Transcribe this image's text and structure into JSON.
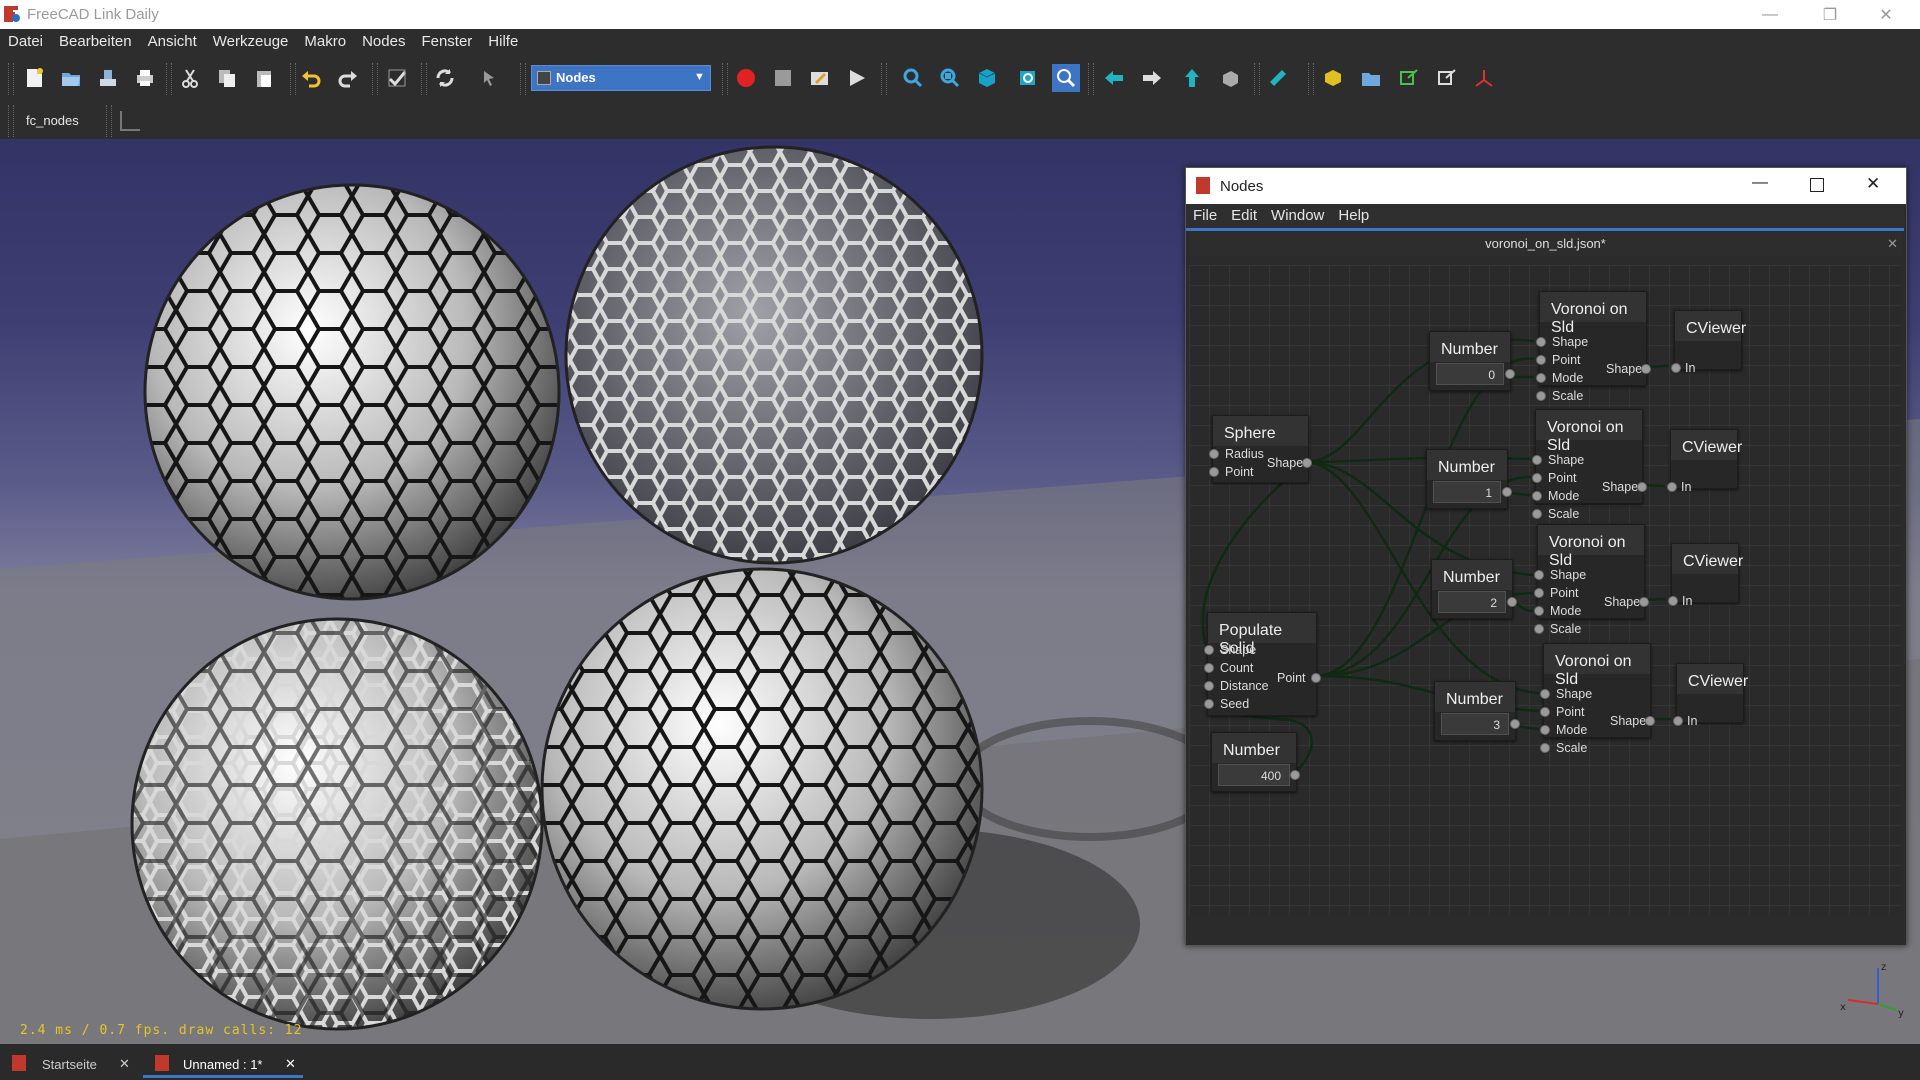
{
  "window": {
    "title": "FreeCAD Link Daily"
  },
  "menubar": [
    "Datei",
    "Bearbeiten",
    "Ansicht",
    "Werkzeuge",
    "Makro",
    "Nodes",
    "Fenster",
    "Hilfe"
  ],
  "workbench_combo": {
    "value": "Nodes"
  },
  "toolbar2": {
    "label": "fc_nodes"
  },
  "viewport": {
    "fps_text": "2.4 ms / 0.7 fps. draw calls: 12"
  },
  "doc_tabs": [
    {
      "label": "Startseite",
      "close": "✕"
    },
    {
      "label": "Unnamed : 1*",
      "close": "✕"
    }
  ],
  "nodes_window": {
    "title": "Nodes",
    "menu": [
      "File",
      "Edit",
      "Window",
      "Help"
    ],
    "file_tab": "voronoi_on_sld.json*",
    "tab_close": "✕",
    "graph": {
      "sphere": {
        "title": "Sphere",
        "inputs": [
          "Radius",
          "Point"
        ],
        "output": "Shape"
      },
      "populate": {
        "title": "Populate Solid",
        "inputs": [
          "Shape",
          "Count",
          "Distance",
          "Seed"
        ],
        "output": "Point"
      },
      "count_number": {
        "title": "Number",
        "value": "400"
      },
      "numbers": [
        {
          "title": "Number",
          "value": "0"
        },
        {
          "title": "Number",
          "value": "1"
        },
        {
          "title": "Number",
          "value": "2"
        },
        {
          "title": "Number",
          "value": "3"
        }
      ],
      "voronoi": [
        {
          "title": "Voronoi on Sld",
          "inputs": [
            "Shape",
            "Point",
            "Mode",
            "Scale"
          ],
          "output": "Shape"
        },
        {
          "title": "Voronoi on Sld",
          "inputs": [
            "Shape",
            "Point",
            "Mode",
            "Scale"
          ],
          "output": "Shape"
        },
        {
          "title": "Voronoi on Sld",
          "inputs": [
            "Shape",
            "Point",
            "Mode",
            "Scale"
          ],
          "output": "Shape"
        },
        {
          "title": "Voronoi on Sld",
          "inputs": [
            "Shape",
            "Point",
            "Mode",
            "Scale"
          ],
          "output": "Shape"
        }
      ],
      "viewers": [
        {
          "title": "CViewer",
          "input": "In"
        },
        {
          "title": "CViewer",
          "input": "In"
        },
        {
          "title": "CViewer",
          "input": "In"
        },
        {
          "title": "CViewer",
          "input": "In"
        }
      ]
    }
  },
  "axis_labels": {
    "x": "x",
    "y": "y",
    "z": "z"
  },
  "colors": {
    "accent": "#3a77c7",
    "fps_text": "#e5c624",
    "viewport_top": "#333366"
  }
}
